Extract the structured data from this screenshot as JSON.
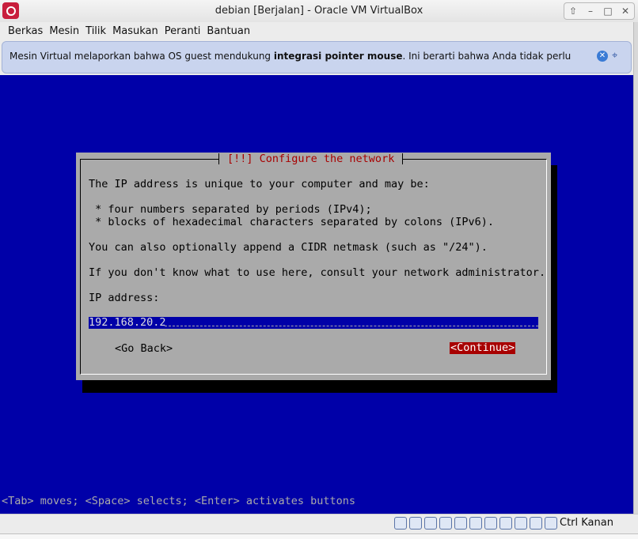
{
  "window": {
    "title": "debian [Berjalan] - Oracle VM VirtualBox",
    "controls": [
      "⇧",
      "–",
      "□",
      "✕"
    ]
  },
  "menu": [
    "Berkas",
    "Mesin",
    "Tilik",
    "Masukan",
    "Peranti",
    "Bantuan"
  ],
  "notice": {
    "text_before": "Mesin Virtual melaporkan bahwa OS guest mendukung ",
    "text_bold": "integrasi pointer mouse",
    "text_after": ". Ini berarti bahwa Anda tidak perlu",
    "close_icon": "close-icon",
    "mouse_icon": "mouse-integration-icon"
  },
  "installer": {
    "title": "[!!] Configure the network",
    "lines": [
      "The IP address is unique to your computer and may be:",
      " * four numbers separated by periods (IPv4);",
      " * blocks of hexadecimal characters separated by colons (IPv6).",
      "You can also optionally append a CIDR netmask (such as \"/24\").",
      "If you don't know what to use here, consult your network administrator.",
      "IP address:"
    ],
    "ip_value": "192.168.20.2",
    "go_back": "<Go Back>",
    "continue": "<Continue>",
    "hint": "<Tab> moves; <Space> selects; <Enter> activates buttons"
  },
  "statusbar": {
    "host_key": "Ctrl Kanan",
    "icons": [
      "hard-disk-icon",
      "optical-drive-icon",
      "audio-icon",
      "network-icon",
      "usb-icon",
      "shared-folder-icon",
      "display-icon",
      "recording-icon",
      "cpu-icon",
      "mouse-icon",
      "keyboard-icon"
    ]
  },
  "colors": {
    "vm_bg": "#0000a8",
    "dialog_bg": "#aaaaaa",
    "title_red": "#a80000"
  }
}
